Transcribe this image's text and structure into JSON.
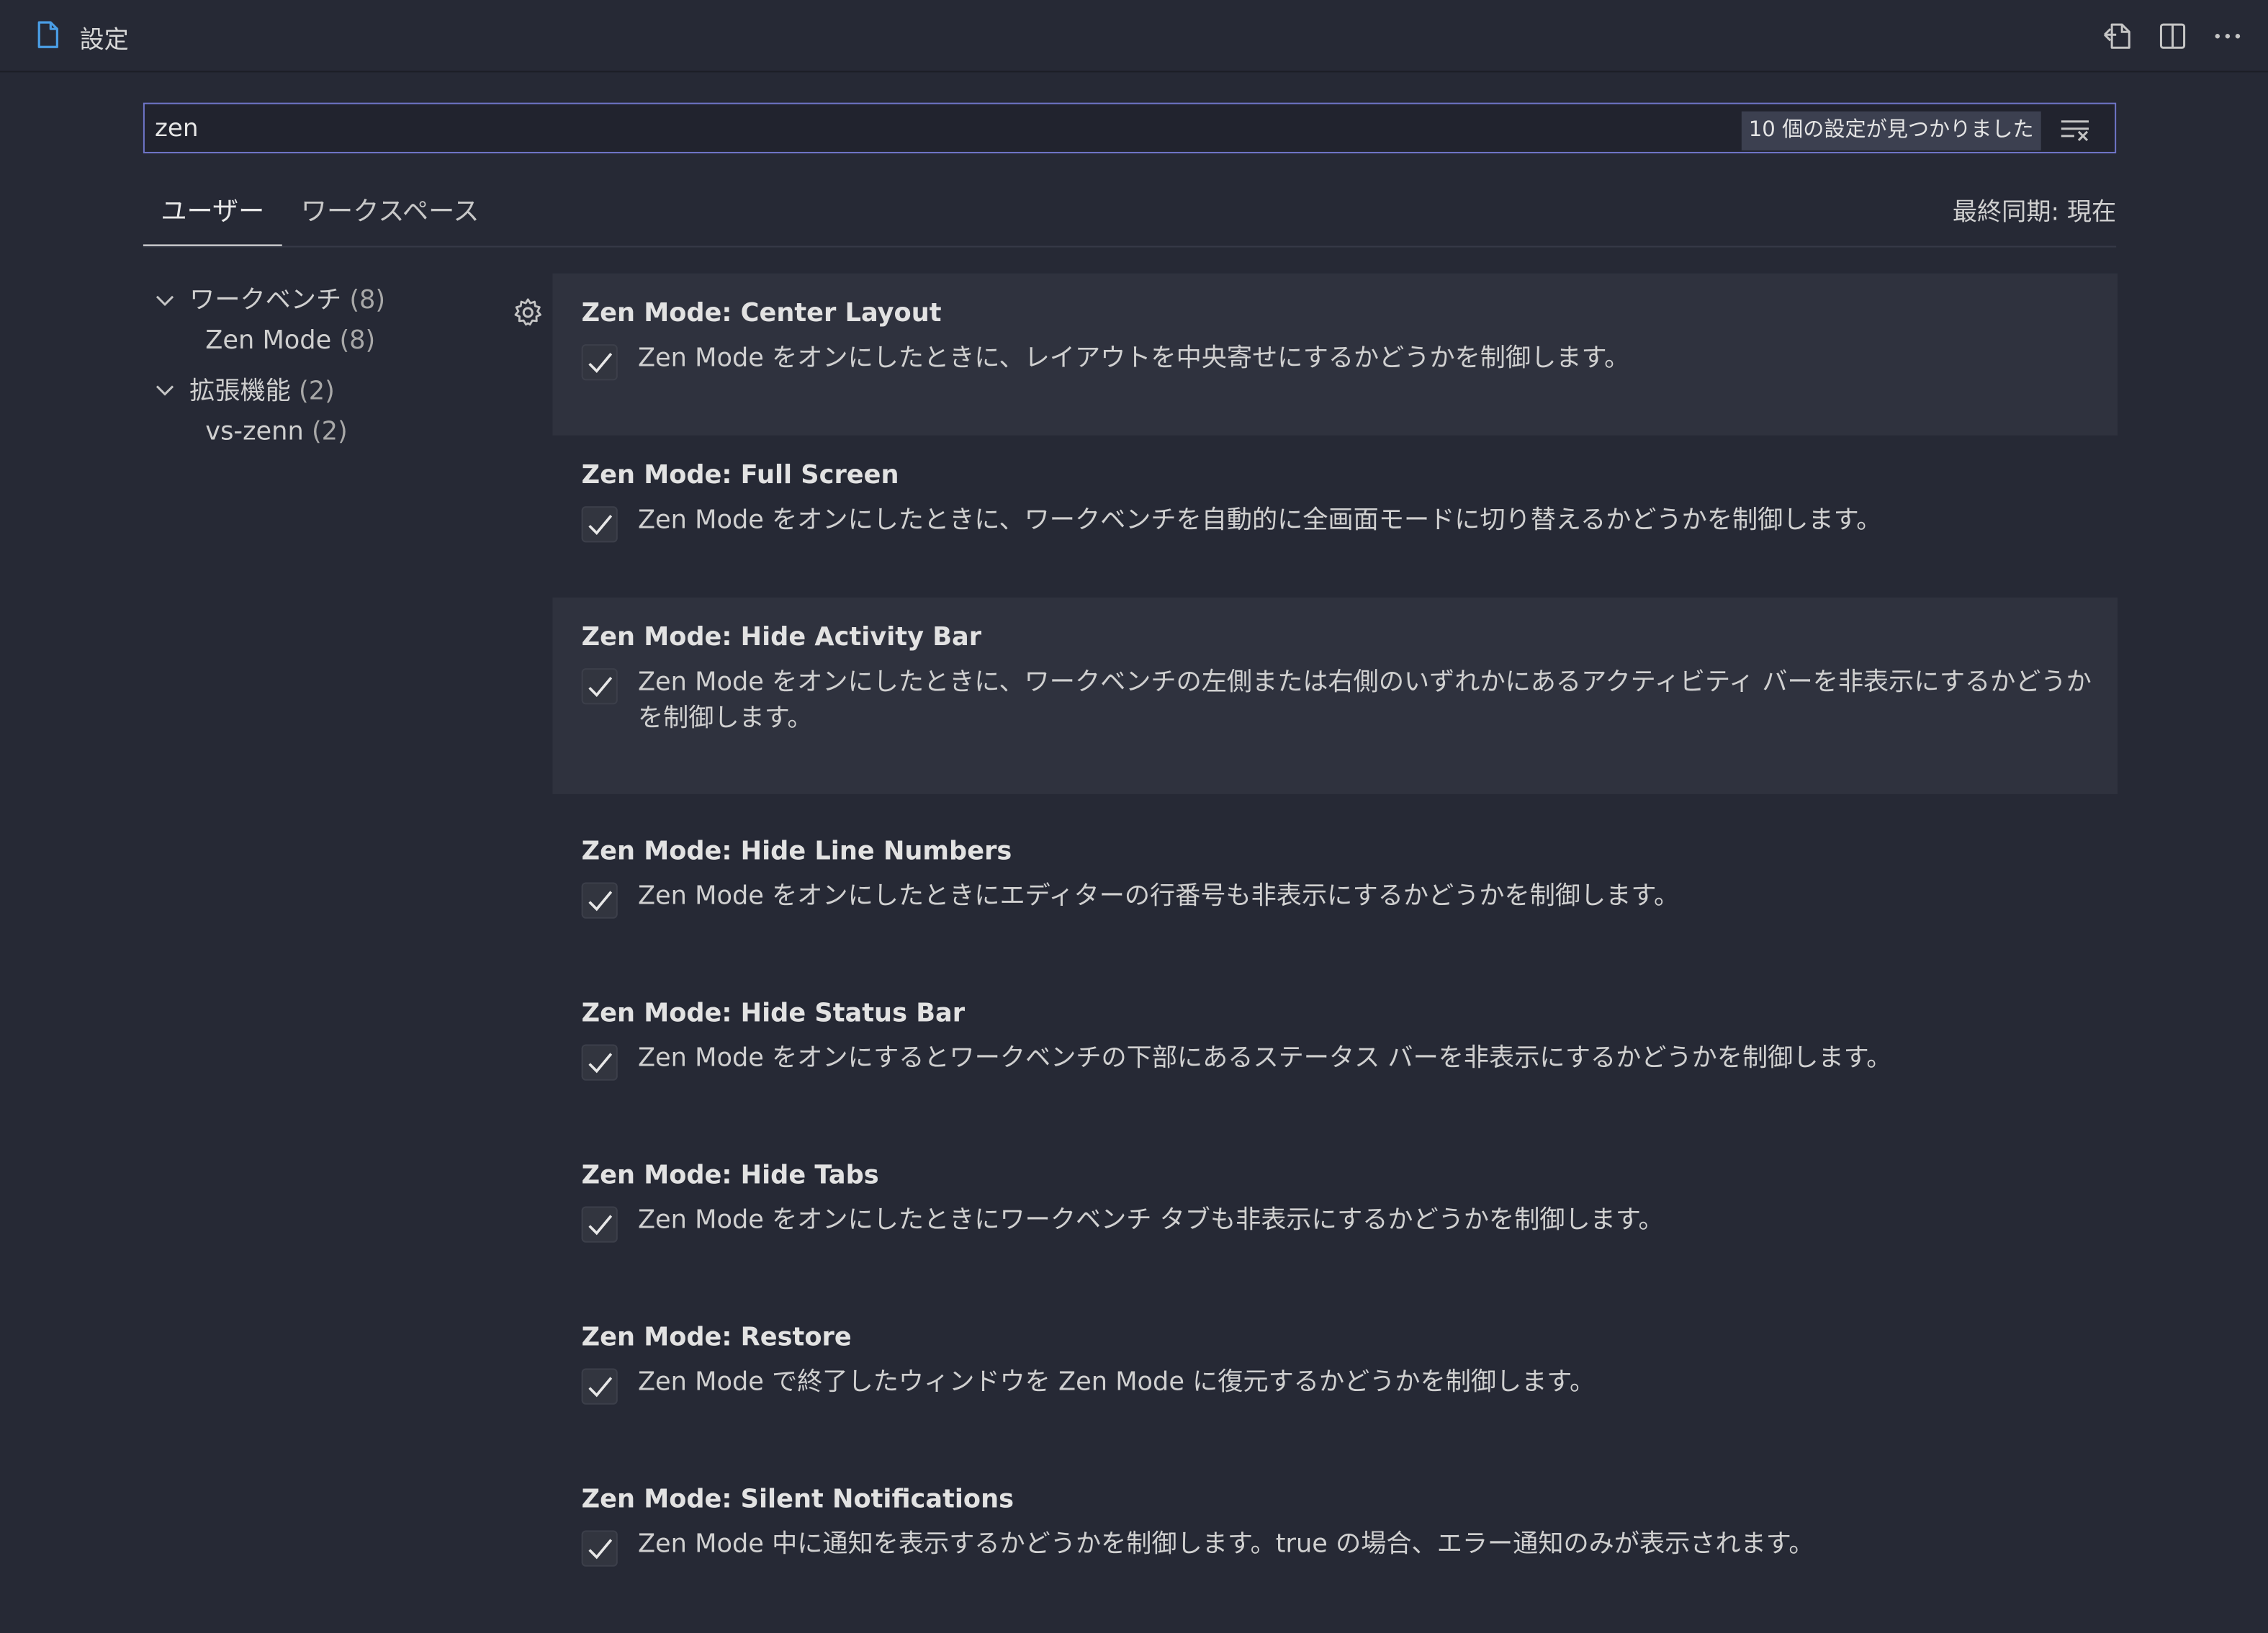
{
  "editor": {
    "tab_title": "設定",
    "tab_icon": "file-icon",
    "actions": [
      "open-settings-json-icon",
      "split-editor-icon",
      "more-actions-icon"
    ]
  },
  "search": {
    "value": "zen",
    "placeholder": "",
    "result_count": "10 個の設定が見つかりました",
    "clear_icon": "clear-filter-icon"
  },
  "scopes": {
    "user": "ユーザー",
    "workspace": "ワークスペース",
    "sync_status": "最終同期: 現在"
  },
  "toc": {
    "items": [
      {
        "label": "ワークベンチ",
        "count": "(8)",
        "level": 0,
        "expanded": true
      },
      {
        "label": "Zen Mode",
        "count": "(8)",
        "level": 1
      },
      {
        "label": "拡張機能",
        "count": "(2)",
        "level": 0,
        "expanded": true
      },
      {
        "label": "vs-zenn",
        "count": "(2)",
        "level": 1
      }
    ]
  },
  "settings": [
    {
      "title": "Zen Mode: Center Layout",
      "checked": true,
      "description": "Zen Mode をオンにしたときに、レイアウトを中央寄せにするかどうかを制御します。"
    },
    {
      "title": "Zen Mode: Full Screen",
      "checked": true,
      "description": "Zen Mode をオンにしたときに、ワークベンチを自動的に全画面モードに切り替えるかどうかを制御します。"
    },
    {
      "title": "Zen Mode: Hide Activity Bar",
      "checked": true,
      "description": "Zen Mode をオンにしたときに、ワークベンチの左側または右側のいずれかにあるアクティビティ バーを非表示にするかどうかを制御します。"
    },
    {
      "title": "Zen Mode: Hide Line Numbers",
      "checked": true,
      "description": "Zen Mode をオンにしたときにエディターの行番号も非表示にするかどうかを制御します。"
    },
    {
      "title": "Zen Mode: Hide Status Bar",
      "checked": true,
      "description": "Zen Mode をオンにするとワークベンチの下部にあるステータス バーを非表示にするかどうかを制御します。"
    },
    {
      "title": "Zen Mode: Hide Tabs",
      "checked": true,
      "description": "Zen Mode をオンにしたときにワークベンチ タブも非表示にするかどうかを制御します。"
    },
    {
      "title": "Zen Mode: Restore",
      "checked": true,
      "description": "Zen Mode で終了したウィンドウを Zen Mode に復元するかどうかを制御します。"
    },
    {
      "title": "Zen Mode: Silent Notifications",
      "checked": true,
      "description": "Zen Mode 中に通知を表示するかどうかを制御します。true の場合、エラー通知のみが表示されます。"
    }
  ],
  "colors": {
    "background": "#262935",
    "focus_border": "#6f75c8",
    "highlight_row": "#2f323e",
    "accent_icon": "#4a9ee6"
  }
}
